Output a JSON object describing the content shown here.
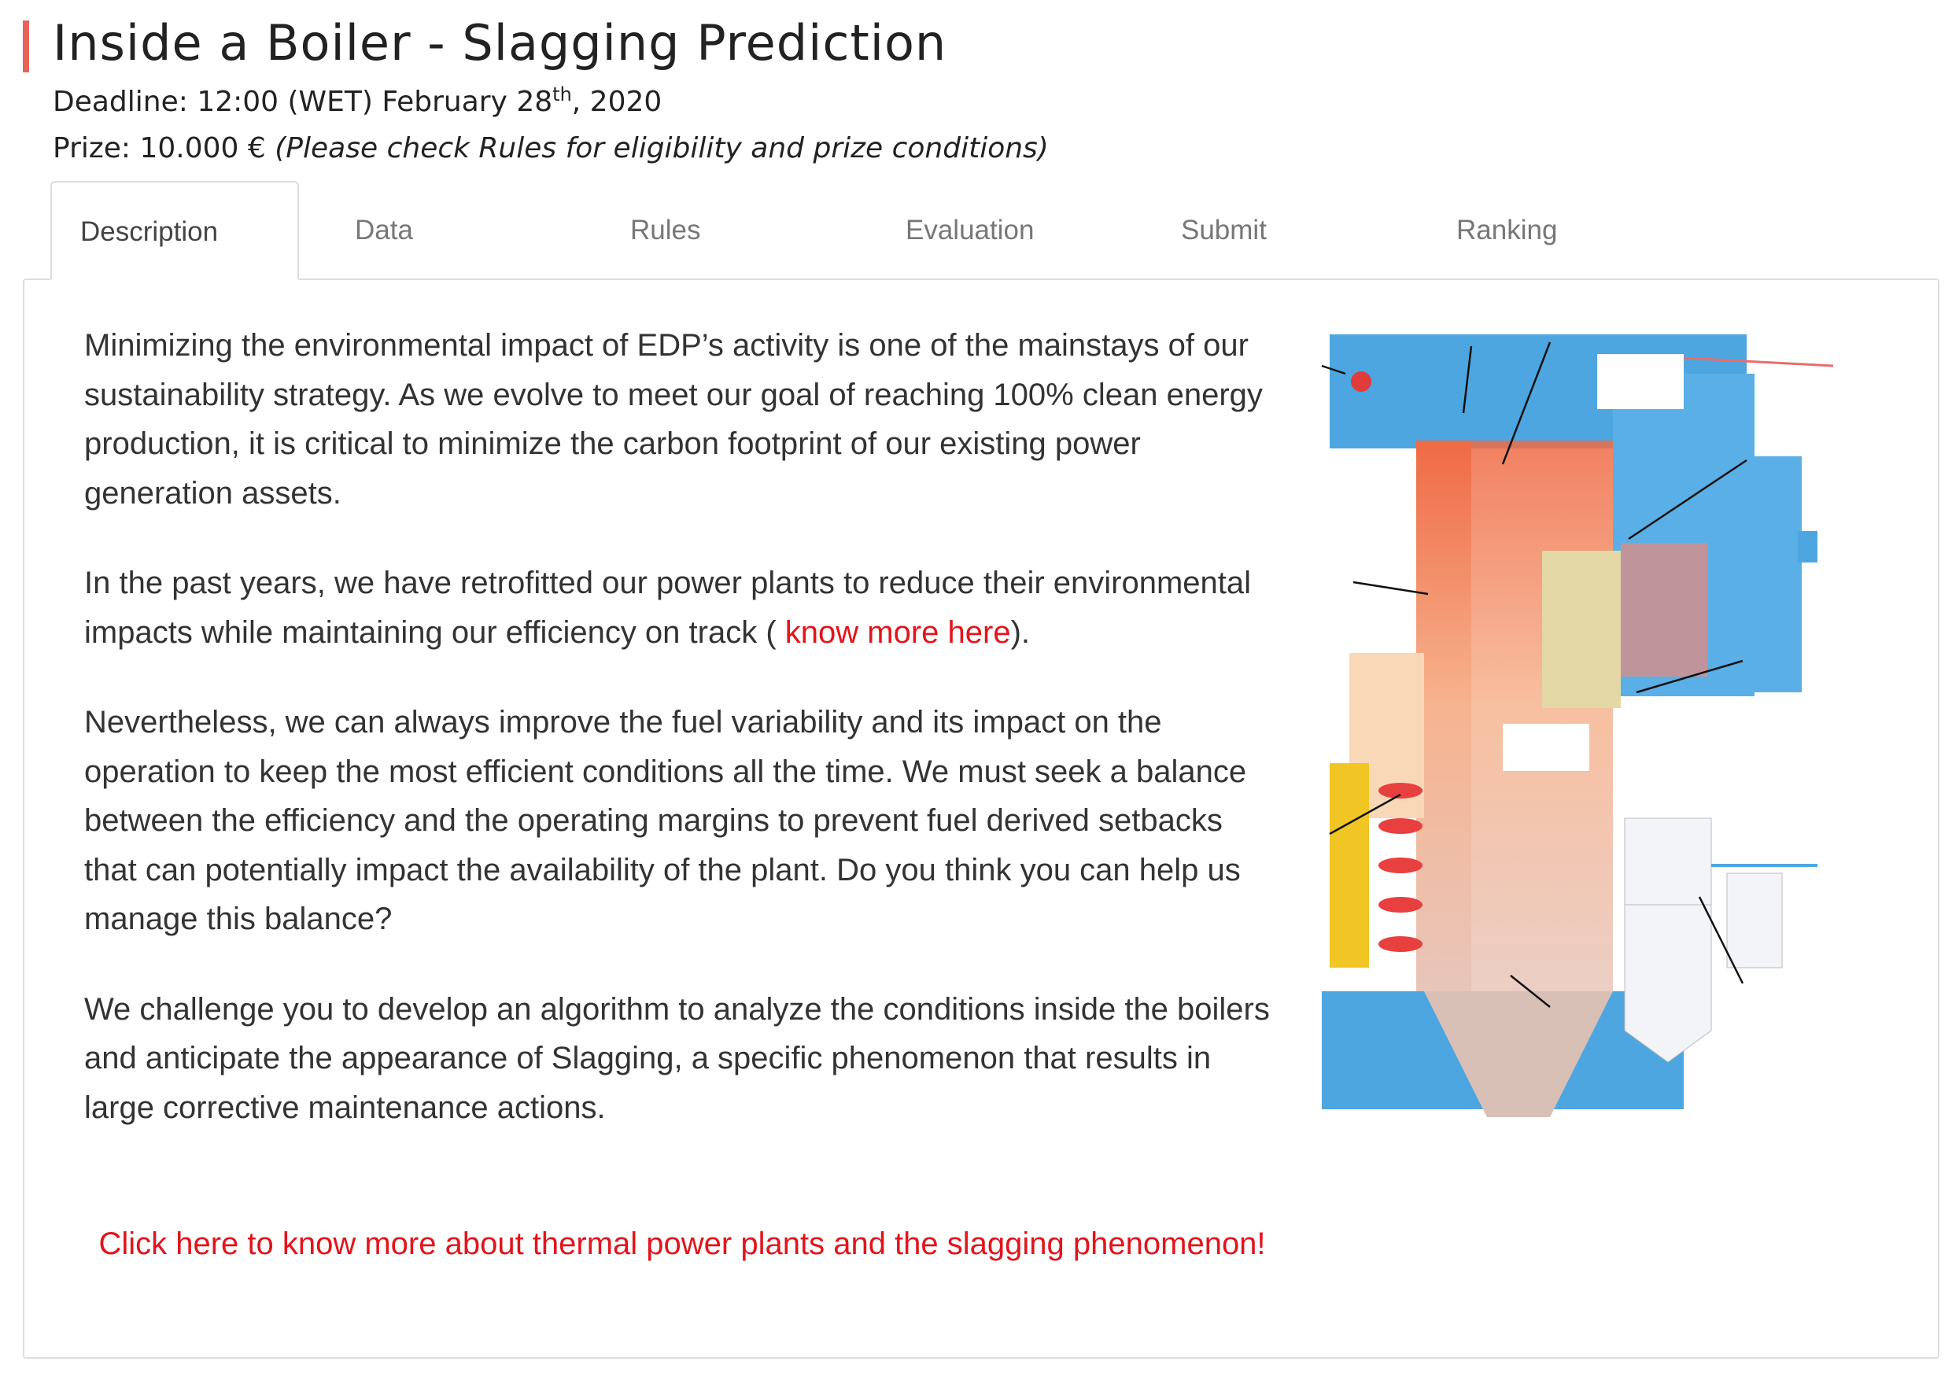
{
  "header": {
    "title": "Inside a Boiler - Slagging Prediction",
    "deadline_prefix": "Deadline: 12:00 (WET) February 28",
    "deadline_sup": "th",
    "deadline_suffix": ", 2020",
    "prize_label": "Prize: 10.000 €",
    "prize_note": "(Please check Rules for eligibility and prize conditions)"
  },
  "tabs": [
    {
      "label": "Description",
      "active": true
    },
    {
      "label": "Data"
    },
    {
      "label": "Rules"
    },
    {
      "label": "Evaluation"
    },
    {
      "label": "Submit"
    },
    {
      "label": "Ranking"
    }
  ],
  "description": {
    "p1": "Minimizing the environmental impact of EDP’s activity is one of the mainstays of our sustainability strategy. As we evolve to meet our goal of reaching 100% clean energy production, it is critical to minimize the carbon footprint of our existing power generation assets.",
    "p2_text": "In the past years, we have retrofitted our power plants to reduce their environmental impacts while maintaining our efficiency on track (",
    "p2_link": " know more here",
    "p2_end": ").",
    "p3": "Nevertheless, we can always improve the fuel variability and its impact on the operation to keep the most efficient conditions all the time. We must seek a balance between the efficiency and the operating margins to prevent fuel derived setbacks that can potentially impact the availability of the plant. Do you think you can help us manage this balance?",
    "p4": "We challenge you to develop an algorithm to analyze the conditions inside the boilers and anticipate the appearance of Slagging, a specific phenomenon that results in large corrective maintenance actions.",
    "cta": "Click here to know more about thermal power plants and the slagging phenomenon!"
  },
  "colors": {
    "accent": "#e8625a",
    "link": "#e3141b",
    "boiler_blue": "#4da6e0"
  }
}
